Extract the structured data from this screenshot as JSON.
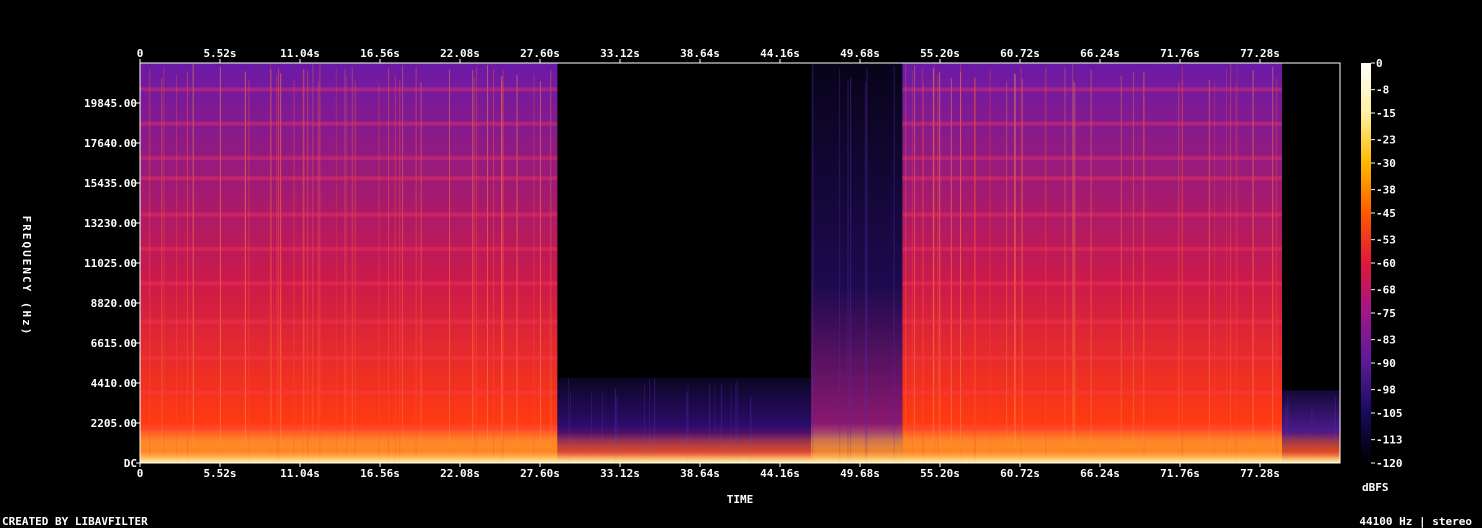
{
  "chart_data": {
    "type": "heatmap",
    "title": "",
    "xlabel": "TIME",
    "ylabel": "FREQUENCY (Hz)",
    "colorbar_label": "dBFS",
    "x_ticks": [
      "0",
      "5.52s",
      "11.04s",
      "16.56s",
      "22.08s",
      "27.60s",
      "33.12s",
      "38.64s",
      "44.16s",
      "49.68s",
      "55.20s",
      "60.72s",
      "66.24s",
      "71.76s",
      "77.28s"
    ],
    "x_tick_values": [
      0,
      5.52,
      11.04,
      16.56,
      22.08,
      27.6,
      33.12,
      38.64,
      44.16,
      49.68,
      55.2,
      60.72,
      66.24,
      71.76,
      77.28
    ],
    "x_range": [
      0,
      82.8
    ],
    "y_ticks": [
      "DC",
      "2205.00",
      "4410.00",
      "6615.00",
      "8820.00",
      "11025.00",
      "13230.00",
      "15435.00",
      "17640.00",
      "19845.00"
    ],
    "y_tick_values": [
      0,
      2205,
      4410,
      6615,
      8820,
      11025,
      13230,
      15435,
      17640,
      19845
    ],
    "y_range": [
      0,
      22050
    ],
    "colorbar_ticks": [
      "0",
      "-8",
      "-15",
      "-23",
      "-30",
      "-38",
      "-45",
      "-53",
      "-60",
      "-68",
      "-75",
      "-83",
      "-90",
      "-98",
      "-105",
      "-113",
      "-120"
    ],
    "colorbar_range": [
      -120,
      0
    ],
    "colors": [
      "#000000",
      "#1a0a5e",
      "#5a1a9a",
      "#a0168c",
      "#e0183a",
      "#ff5a00",
      "#ffb800",
      "#fff0a0",
      "#ffffff"
    ],
    "segments": [
      {
        "start": 0.0,
        "end": 28.8,
        "level": "loud"
      },
      {
        "start": 28.8,
        "end": 46.3,
        "level": "quiet"
      },
      {
        "start": 46.3,
        "end": 52.6,
        "level": "sparse"
      },
      {
        "start": 52.6,
        "end": 78.8,
        "level": "loud"
      },
      {
        "start": 78.8,
        "end": 82.8,
        "level": "fade"
      }
    ]
  },
  "footer": {
    "credit": "CREATED BY LIBAVFILTER",
    "info": "44100 Hz | stereo"
  }
}
